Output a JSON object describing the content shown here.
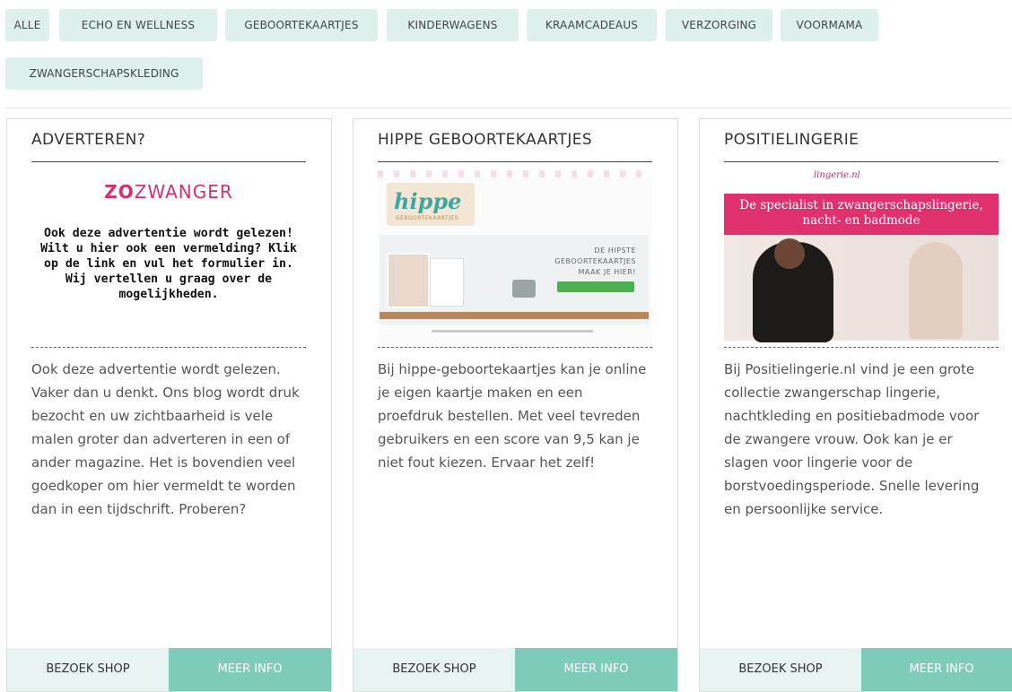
{
  "filters": [
    "ALLE",
    "ECHO EN WELLNESS",
    "GEBOORTEKAARTJES",
    "KINDERWAGENS",
    "KRAAMCADEAUS",
    "VERZORGING",
    "VOORMAMA",
    "ZWANGERSCHAPSKLEDING"
  ],
  "cards": [
    {
      "title": "ADVERTEREN?",
      "image": {
        "logo_prefix": "ZO",
        "logo_suffix": "ZWANGER",
        "text": "Ook deze advertentie wordt gelezen! Wilt u hier ook een vermelding? Klik op de link en vul het formulier in. Wij vertellen u graag over de mogelijkheden."
      },
      "description": "Ook deze advertentie wordt gelezen. Vaker dan u denkt. Ons blog wordt druk bezocht en uw zichtbaarheid is vele malen groter dan adverteren in een of ander magazine. Het is bovendien veel goedkoper om hier vermeldt te worden dan in een tijdschrift. Proberen?",
      "shop_label": "BEZOEK SHOP",
      "info_label": "MEER INFO"
    },
    {
      "title": "HIPPE GEBOORTEKAARTJES",
      "image": {
        "brand": "hippe",
        "brand_sub": "GEBOORTEKAARTJES",
        "headline": "DE HIPSTE GEBOORTEKAARTJES MAAK JE HIER!"
      },
      "description": "Bij hippe-geboortekaartjes kan je online je eigen kaartje maken en een proefdruk bestellen. Met veel tevreden gebruikers en een score van 9,5 kan je niet fout kiezen. Ervaar het zelf!",
      "shop_label": "BEZOEK SHOP",
      "info_label": "MEER INFO"
    },
    {
      "title": "POSITIELINGERIE",
      "image": {
        "header": "lingerie.nl",
        "banner": "De specialist in zwangerschapslingerie, nacht- en badmode"
      },
      "description": "Bij Positielingerie.nl vind je een grote collectie zwangerschap lingerie, nachtkleding en positiebadmode voor de zwangere vrouw. Ook kan je er slagen voor lingerie voor de borstvoedingsperiode. Snelle levering en persoonlijke service.",
      "shop_label": "BEZOEK SHOP",
      "info_label": "MEER INFO"
    }
  ],
  "colors": {
    "chip_bg": "#ddf0ec",
    "info_button": "#7fcbb9",
    "shop_button": "#e8f4f1",
    "brand_pink": "#e0306e"
  }
}
